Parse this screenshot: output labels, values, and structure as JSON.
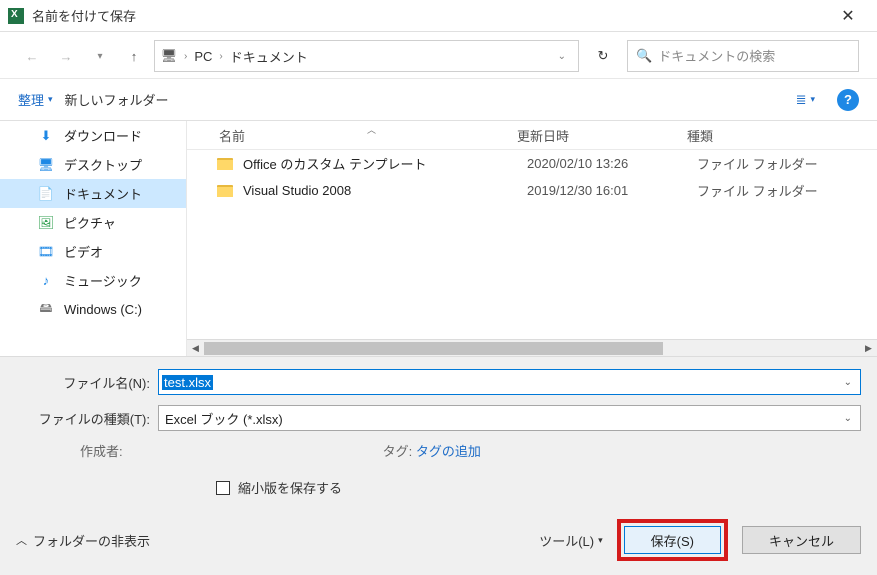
{
  "window": {
    "title": "名前を付けて保存"
  },
  "nav": {
    "breadcrumb_root": "PC",
    "breadcrumb_current": "ドキュメント",
    "search_placeholder": "ドキュメントの検索"
  },
  "toolbar": {
    "organize": "整理",
    "new_folder": "新しいフォルダー"
  },
  "sidebar": {
    "items": [
      {
        "label": "ダウンロード"
      },
      {
        "label": "デスクトップ"
      },
      {
        "label": "ドキュメント"
      },
      {
        "label": "ピクチャ"
      },
      {
        "label": "ビデオ"
      },
      {
        "label": "ミュージック"
      },
      {
        "label": "Windows (C:)"
      }
    ]
  },
  "columns": {
    "name": "名前",
    "date": "更新日時",
    "type": "種類"
  },
  "rows": [
    {
      "name": "Office のカスタム テンプレート",
      "date": "2020/02/10 13:26",
      "type": "ファイル フォルダー"
    },
    {
      "name": "Visual Studio 2008",
      "date": "2019/12/30 16:01",
      "type": "ファイル フォルダー"
    }
  ],
  "form": {
    "filename_label": "ファイル名(N):",
    "filename_value": "test.xlsx",
    "filetype_label": "ファイルの種類(T):",
    "filetype_value": "Excel ブック (*.xlsx)",
    "author_label": "作成者:",
    "tag_label": "タグ:",
    "tag_add": "タグの追加",
    "thumb_label": "縮小版を保存する"
  },
  "footer": {
    "hide_folders": "フォルダーの非表示",
    "tools": "ツール(L)",
    "save": "保存(S)",
    "cancel": "キャンセル"
  }
}
